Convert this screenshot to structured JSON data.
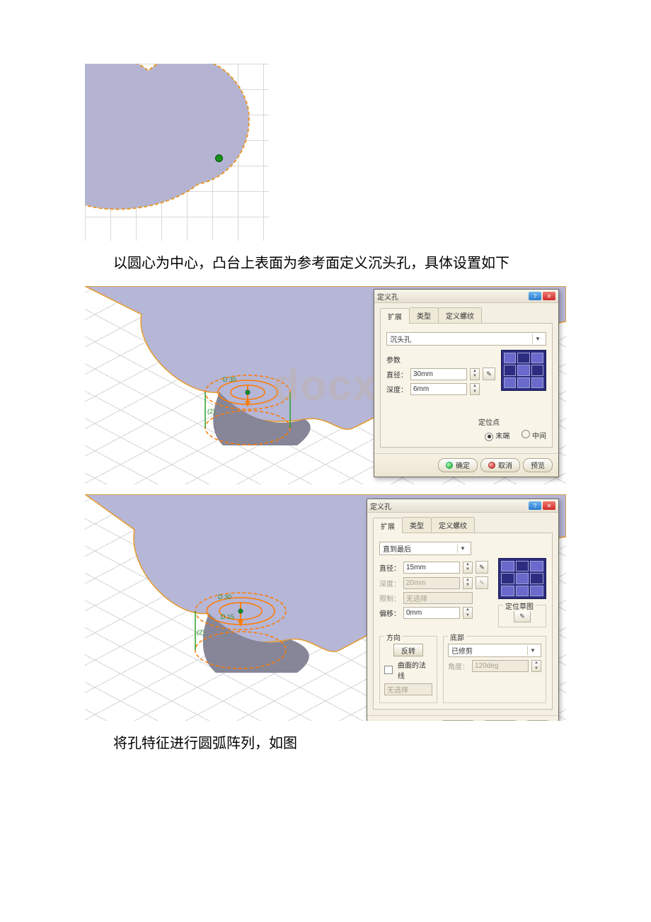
{
  "text": {
    "instruction1": "以圆心为中心，凸台上表面为参考面定义沉头孔，具体设置如下",
    "instruction2": "将孔特征进行圆弧阵列，如图"
  },
  "dialog_common": {
    "title": "定义孔",
    "tabs": {
      "t1": "扩展",
      "t2": "类型",
      "t3": "定义螺纹"
    },
    "buttons": {
      "ok": "确定",
      "cancel": "取消",
      "preview": "预览"
    }
  },
  "dialog1": {
    "type_value": "沉头孔",
    "group_param": "参数",
    "labels": {
      "diameter": "直径：",
      "depth": "深度："
    },
    "values": {
      "diameter": "30mm",
      "depth": "6mm"
    },
    "anchor_group": "定位点",
    "anchor": {
      "opt1": "末端",
      "opt2": "中间"
    }
  },
  "dialog2": {
    "type_value": "直到最后",
    "labels": {
      "diameter": "直径：",
      "depth": "深度：",
      "limit": "限制：",
      "offset": "偏移：",
      "direction_group": "方向",
      "reverse": "反转",
      "surface_normal": "曲面的法线",
      "no_selection": "无选择",
      "bottom_group": "底部",
      "angle": "角度：",
      "sketch_group": "定位草图"
    },
    "values": {
      "diameter": "15mm",
      "depth": "20mm",
      "limit": "无选择",
      "offset": "0mm",
      "bottom_value": "已修剪",
      "angle": "120deg"
    }
  }
}
